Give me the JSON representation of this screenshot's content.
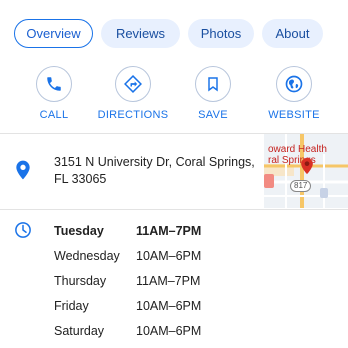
{
  "tabs": [
    {
      "label": "Overview",
      "active": true
    },
    {
      "label": "Reviews",
      "active": false
    },
    {
      "label": "Photos",
      "active": false
    },
    {
      "label": "About",
      "active": false
    }
  ],
  "actions": [
    {
      "label": "CALL",
      "icon": "phone-icon"
    },
    {
      "label": "DIRECTIONS",
      "icon": "directions-icon"
    },
    {
      "label": "SAVE",
      "icon": "bookmark-icon"
    },
    {
      "label": "WEBSITE",
      "icon": "globe-icon"
    }
  ],
  "address": {
    "line1": "3151 N University Dr, Coral Springs,",
    "line2": "FL 33065",
    "icon": "location-pin-icon"
  },
  "map": {
    "label_line1": "oward Health",
    "label_line2": "ral Springs",
    "route_badge": "817"
  },
  "hours": {
    "icon": "clock-icon",
    "rows": [
      {
        "day": "Tuesday",
        "time": "11AM–7PM",
        "today": true
      },
      {
        "day": "Wednesday",
        "time": "10AM–6PM",
        "today": false
      },
      {
        "day": "Thursday",
        "time": "11AM–7PM",
        "today": false
      },
      {
        "day": "Friday",
        "time": "10AM–6PM",
        "today": false
      },
      {
        "day": "Saturday",
        "time": "10AM–6PM",
        "today": false
      }
    ]
  },
  "colors": {
    "accent": "#1a73e8",
    "chip_background": "#e8f0fe",
    "pin": "#1a73e8",
    "map_marker": "#d93025"
  }
}
